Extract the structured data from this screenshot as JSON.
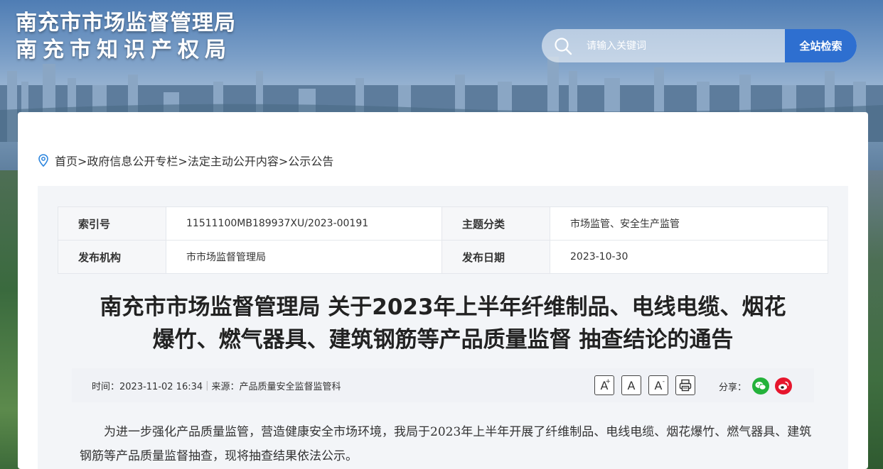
{
  "header": {
    "site_title_line1": "南充市市场监督管理局",
    "site_title_line2": "南充市知识产权局"
  },
  "search": {
    "placeholder": "请输入关键词",
    "button_label": "全站检索",
    "accent": "#2e6fd0"
  },
  "breadcrumb": {
    "text": "首页>政府信息公开专栏>法定主动公开内容>公示公告"
  },
  "meta": {
    "index_label": "索引号",
    "index_value": "11511100MB189937XU/2023-00191",
    "topic_label": "主题分类",
    "topic_value": "市场监管、安全生产监管",
    "issuer_label": "发布机构",
    "issuer_value": "市市场监督管理局",
    "date_label": "发布日期",
    "date_value": "2023-10-30"
  },
  "article": {
    "title": "南充市市场监督管理局 关于2023年上半年纤维制品、电线电缆、烟花爆竹、燃气器具、建筑钢筋等产品质量监督 抽查结论的通告",
    "time_text": "时间：2023-11-02 16:34",
    "source_text": "来源：产品质量安全监督监管科",
    "font_increase": "A",
    "font_normal": "A",
    "font_decrease": "A",
    "font_increase_sup": "+",
    "font_decrease_sup": "-",
    "share_label": "分享：",
    "paragraph1": "为进一步强化产品质量监管，营造健康安全市场环境，我局于2023年上半年开展了纤维制品、电线电缆、烟花爆竹、燃气器具、建筑钢筋等产品质量监督抽查，现将抽查结果依法公示。"
  }
}
